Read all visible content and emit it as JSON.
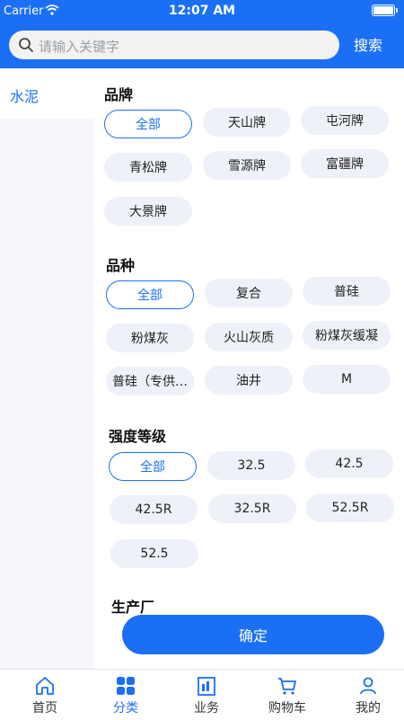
{
  "status_bar": {
    "carrier": "Carrier",
    "time": "12:07 AM"
  },
  "search": {
    "placeholder": "请输入关键字",
    "button_label": "搜索"
  },
  "sidebar": {
    "items": [
      {
        "label": "水泥"
      }
    ]
  },
  "sections": {
    "brand": {
      "title": "品牌",
      "options": [
        "全部",
        "天山牌",
        "屯河牌",
        "青松牌",
        "雪源牌",
        "富疆牌",
        "大景牌"
      ],
      "selected": "全部"
    },
    "variety": {
      "title": "品种",
      "options": [
        "全部",
        "复合",
        "普硅",
        "粉煤灰",
        "火山灰质",
        "粉煤灰缓凝",
        "普硅（专供…",
        "油井",
        "M"
      ],
      "selected": "全部"
    },
    "strength": {
      "title": "强度等级",
      "options": [
        "全部",
        "32.5",
        "42.5",
        "42.5R",
        "32.5R",
        "52.5R",
        "52.5"
      ],
      "selected": "全部"
    },
    "manufacturer": {
      "title": "生产厂"
    }
  },
  "confirm_label": "确定",
  "tabbar": {
    "items": [
      {
        "label": "首页",
        "icon": "home-icon"
      },
      {
        "label": "分类",
        "icon": "category-icon",
        "active": true
      },
      {
        "label": "业务",
        "icon": "business-icon"
      },
      {
        "label": "购物车",
        "icon": "cart-icon"
      },
      {
        "label": "我的",
        "icon": "profile-icon"
      }
    ]
  },
  "colors": {
    "primary": "#1b6ff5",
    "chip_bg": "#eef1f7",
    "sidebar_bg": "#f5f7fb"
  }
}
